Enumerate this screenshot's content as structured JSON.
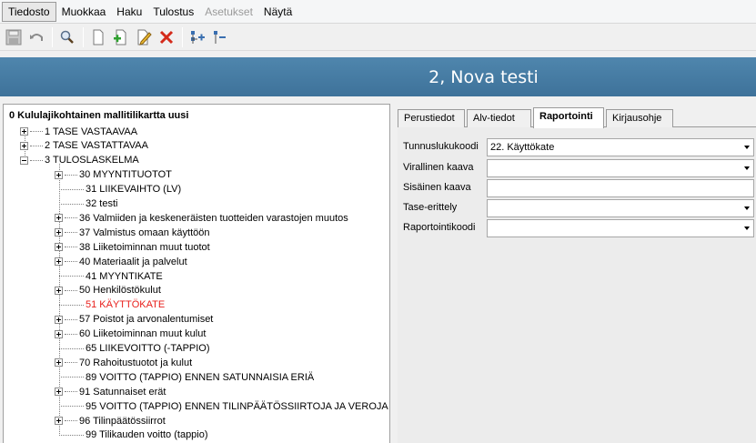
{
  "menu": [
    {
      "label": "Tiedosto",
      "active": true,
      "disabled": false
    },
    {
      "label": "Muokkaa",
      "active": false,
      "disabled": false
    },
    {
      "label": "Haku",
      "active": false,
      "disabled": false
    },
    {
      "label": "Tulostus",
      "active": false,
      "disabled": false
    },
    {
      "label": "Asetukset",
      "active": false,
      "disabled": true
    },
    {
      "label": "Näytä",
      "active": false,
      "disabled": false
    }
  ],
  "toolbar": {
    "icons": [
      "save-icon",
      "undo-icon",
      "search-icon",
      "new-document-icon",
      "add-document-icon",
      "edit-document-icon",
      "delete-icon",
      "expand-tree-icon",
      "collapse-tree-icon"
    ]
  },
  "banner": {
    "title": "2, Nova testi"
  },
  "tree": {
    "root": "0 Kululajikohtainen mallitilikartta uusi",
    "top": [
      {
        "label": "1 TASE VASTAAVAA",
        "expander": "plus"
      },
      {
        "label": "2 TASE VASTATTAVAA",
        "expander": "plus"
      },
      {
        "label": "3 TULOSLASKELMA",
        "expander": "minus"
      }
    ],
    "children": [
      {
        "label": "30 MYYNTITUOTOT",
        "expander": "plus",
        "highlight": false
      },
      {
        "label": "31 LIIKEVAIHTO (LV)",
        "expander": "none",
        "highlight": false
      },
      {
        "label": "32 testi",
        "expander": "none",
        "highlight": false
      },
      {
        "label": "36 Valmiiden ja keskeneräisten tuotteiden varastojen muutos",
        "expander": "plus",
        "highlight": false
      },
      {
        "label": "37 Valmistus omaan käyttöön",
        "expander": "plus",
        "highlight": false
      },
      {
        "label": "38 Liiketoiminnan muut tuotot",
        "expander": "plus",
        "highlight": false
      },
      {
        "label": "40 Materiaalit ja palvelut",
        "expander": "plus",
        "highlight": false
      },
      {
        "label": "41 MYYNTIKATE",
        "expander": "none",
        "highlight": false
      },
      {
        "label": "50 Henkilöstökulut",
        "expander": "plus",
        "highlight": false
      },
      {
        "label": "51 KÄYTTÖKATE",
        "expander": "none",
        "highlight": true
      },
      {
        "label": "57 Poistot ja arvonalentumiset",
        "expander": "plus",
        "highlight": false
      },
      {
        "label": "60 Liiketoiminnan muut kulut",
        "expander": "plus",
        "highlight": false
      },
      {
        "label": "65 LIIKEVOITTO (-TAPPIO)",
        "expander": "none",
        "highlight": false
      },
      {
        "label": "70 Rahoitustuotot ja kulut",
        "expander": "plus",
        "highlight": false
      },
      {
        "label": "89 VOITTO (TAPPIO) ENNEN SATUNNAISIA ERIÄ",
        "expander": "none",
        "highlight": false
      },
      {
        "label": "91 Satunnaiset erät",
        "expander": "plus",
        "highlight": false
      },
      {
        "label": "95 VOITTO (TAPPIO) ENNEN TILINPÄÄTÖSSIIRTOJA JA VEROJA",
        "expander": "none",
        "highlight": false
      },
      {
        "label": "96 Tilinpäätössiirrot",
        "expander": "plus",
        "highlight": false
      },
      {
        "label": "99 Tilikauden voitto (tappio)",
        "expander": "none",
        "highlight": false
      }
    ]
  },
  "tabs": [
    {
      "label": "Perustiedot",
      "active": false
    },
    {
      "label": "Alv-tiedot",
      "active": false
    },
    {
      "label": "Raportointi",
      "active": true
    },
    {
      "label": "Kirjausohje",
      "active": false
    }
  ],
  "form": [
    {
      "label": "Tunnuslukukoodi",
      "value": "22. Käyttökate",
      "combo": true
    },
    {
      "label": "Virallinen kaava",
      "value": "",
      "combo": true
    },
    {
      "label": "Sisäinen kaava",
      "value": "",
      "combo": false
    },
    {
      "label": "Tase-erittely",
      "value": "",
      "combo": true
    },
    {
      "label": "Raportointikoodi",
      "value": "",
      "combo": true
    }
  ],
  "colors": {
    "banner": "#4a7ea5",
    "highlight": "#e8201c"
  }
}
